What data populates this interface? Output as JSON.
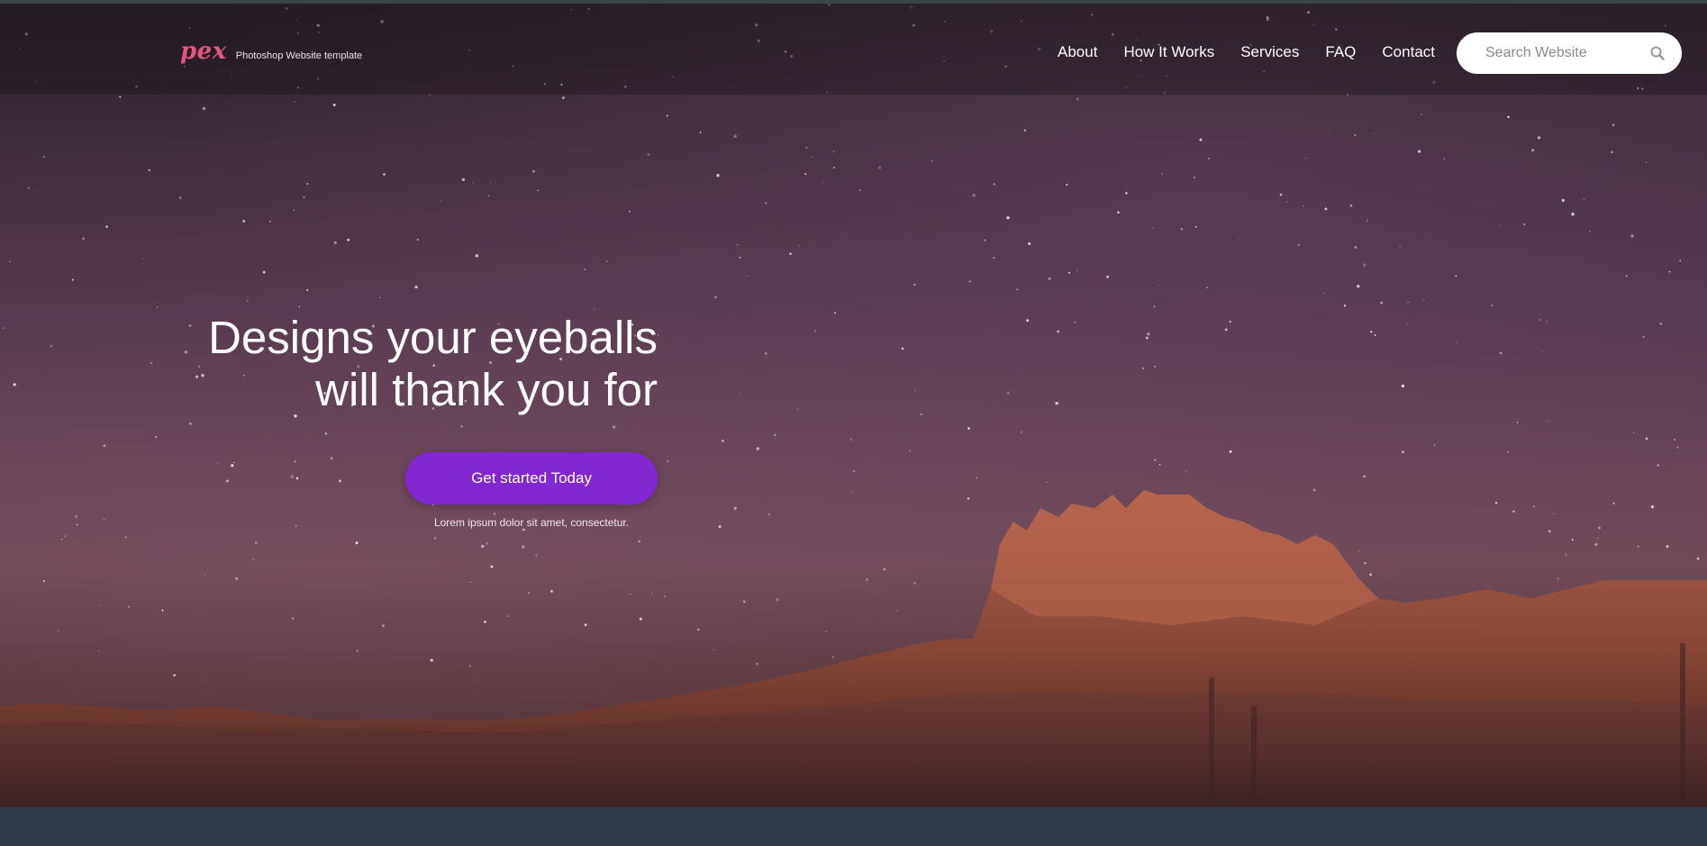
{
  "brand": {
    "logo": "pex",
    "tagline": "Photoshop Website template",
    "accent": "#e05780"
  },
  "nav": {
    "links": [
      "About",
      "How It Works",
      "Services",
      "FAQ",
      "Contact"
    ]
  },
  "search": {
    "placeholder": "Search Website",
    "icon": "search-icon"
  },
  "hero": {
    "headline_line1": "Designs your eyeballs",
    "headline_line2": "will thank you for",
    "cta_label": "Get started Today",
    "cta_color": "#8327d3",
    "cta_note": "Lorem ipsum dolor sit amet, consectetur."
  },
  "colors": {
    "footer_band": "#2f3a4a"
  }
}
